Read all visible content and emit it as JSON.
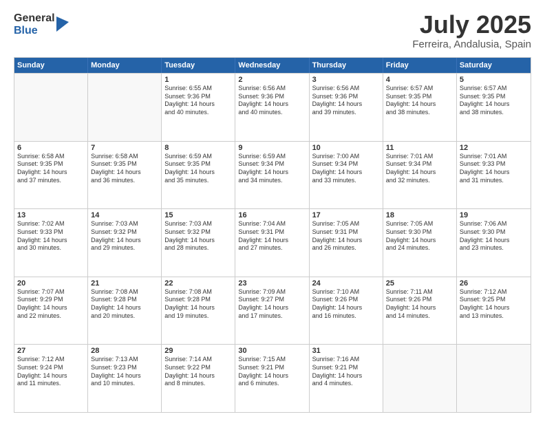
{
  "logo": {
    "general": "General",
    "blue": "Blue"
  },
  "title": {
    "month": "July 2025",
    "location": "Ferreira, Andalusia, Spain"
  },
  "weekdays": [
    "Sunday",
    "Monday",
    "Tuesday",
    "Wednesday",
    "Thursday",
    "Friday",
    "Saturday"
  ],
  "rows": [
    [
      {
        "day": "",
        "lines": [],
        "empty": true
      },
      {
        "day": "",
        "lines": [],
        "empty": true
      },
      {
        "day": "1",
        "lines": [
          "Sunrise: 6:55 AM",
          "Sunset: 9:36 PM",
          "Daylight: 14 hours",
          "and 40 minutes."
        ]
      },
      {
        "day": "2",
        "lines": [
          "Sunrise: 6:56 AM",
          "Sunset: 9:36 PM",
          "Daylight: 14 hours",
          "and 40 minutes."
        ]
      },
      {
        "day": "3",
        "lines": [
          "Sunrise: 6:56 AM",
          "Sunset: 9:36 PM",
          "Daylight: 14 hours",
          "and 39 minutes."
        ]
      },
      {
        "day": "4",
        "lines": [
          "Sunrise: 6:57 AM",
          "Sunset: 9:35 PM",
          "Daylight: 14 hours",
          "and 38 minutes."
        ]
      },
      {
        "day": "5",
        "lines": [
          "Sunrise: 6:57 AM",
          "Sunset: 9:35 PM",
          "Daylight: 14 hours",
          "and 38 minutes."
        ]
      }
    ],
    [
      {
        "day": "6",
        "lines": [
          "Sunrise: 6:58 AM",
          "Sunset: 9:35 PM",
          "Daylight: 14 hours",
          "and 37 minutes."
        ]
      },
      {
        "day": "7",
        "lines": [
          "Sunrise: 6:58 AM",
          "Sunset: 9:35 PM",
          "Daylight: 14 hours",
          "and 36 minutes."
        ]
      },
      {
        "day": "8",
        "lines": [
          "Sunrise: 6:59 AM",
          "Sunset: 9:35 PM",
          "Daylight: 14 hours",
          "and 35 minutes."
        ]
      },
      {
        "day": "9",
        "lines": [
          "Sunrise: 6:59 AM",
          "Sunset: 9:34 PM",
          "Daylight: 14 hours",
          "and 34 minutes."
        ]
      },
      {
        "day": "10",
        "lines": [
          "Sunrise: 7:00 AM",
          "Sunset: 9:34 PM",
          "Daylight: 14 hours",
          "and 33 minutes."
        ]
      },
      {
        "day": "11",
        "lines": [
          "Sunrise: 7:01 AM",
          "Sunset: 9:34 PM",
          "Daylight: 14 hours",
          "and 32 minutes."
        ]
      },
      {
        "day": "12",
        "lines": [
          "Sunrise: 7:01 AM",
          "Sunset: 9:33 PM",
          "Daylight: 14 hours",
          "and 31 minutes."
        ]
      }
    ],
    [
      {
        "day": "13",
        "lines": [
          "Sunrise: 7:02 AM",
          "Sunset: 9:33 PM",
          "Daylight: 14 hours",
          "and 30 minutes."
        ]
      },
      {
        "day": "14",
        "lines": [
          "Sunrise: 7:03 AM",
          "Sunset: 9:32 PM",
          "Daylight: 14 hours",
          "and 29 minutes."
        ]
      },
      {
        "day": "15",
        "lines": [
          "Sunrise: 7:03 AM",
          "Sunset: 9:32 PM",
          "Daylight: 14 hours",
          "and 28 minutes."
        ]
      },
      {
        "day": "16",
        "lines": [
          "Sunrise: 7:04 AM",
          "Sunset: 9:31 PM",
          "Daylight: 14 hours",
          "and 27 minutes."
        ]
      },
      {
        "day": "17",
        "lines": [
          "Sunrise: 7:05 AM",
          "Sunset: 9:31 PM",
          "Daylight: 14 hours",
          "and 26 minutes."
        ]
      },
      {
        "day": "18",
        "lines": [
          "Sunrise: 7:05 AM",
          "Sunset: 9:30 PM",
          "Daylight: 14 hours",
          "and 24 minutes."
        ]
      },
      {
        "day": "19",
        "lines": [
          "Sunrise: 7:06 AM",
          "Sunset: 9:30 PM",
          "Daylight: 14 hours",
          "and 23 minutes."
        ]
      }
    ],
    [
      {
        "day": "20",
        "lines": [
          "Sunrise: 7:07 AM",
          "Sunset: 9:29 PM",
          "Daylight: 14 hours",
          "and 22 minutes."
        ]
      },
      {
        "day": "21",
        "lines": [
          "Sunrise: 7:08 AM",
          "Sunset: 9:28 PM",
          "Daylight: 14 hours",
          "and 20 minutes."
        ]
      },
      {
        "day": "22",
        "lines": [
          "Sunrise: 7:08 AM",
          "Sunset: 9:28 PM",
          "Daylight: 14 hours",
          "and 19 minutes."
        ]
      },
      {
        "day": "23",
        "lines": [
          "Sunrise: 7:09 AM",
          "Sunset: 9:27 PM",
          "Daylight: 14 hours",
          "and 17 minutes."
        ]
      },
      {
        "day": "24",
        "lines": [
          "Sunrise: 7:10 AM",
          "Sunset: 9:26 PM",
          "Daylight: 14 hours",
          "and 16 minutes."
        ]
      },
      {
        "day": "25",
        "lines": [
          "Sunrise: 7:11 AM",
          "Sunset: 9:26 PM",
          "Daylight: 14 hours",
          "and 14 minutes."
        ]
      },
      {
        "day": "26",
        "lines": [
          "Sunrise: 7:12 AM",
          "Sunset: 9:25 PM",
          "Daylight: 14 hours",
          "and 13 minutes."
        ]
      }
    ],
    [
      {
        "day": "27",
        "lines": [
          "Sunrise: 7:12 AM",
          "Sunset: 9:24 PM",
          "Daylight: 14 hours",
          "and 11 minutes."
        ]
      },
      {
        "day": "28",
        "lines": [
          "Sunrise: 7:13 AM",
          "Sunset: 9:23 PM",
          "Daylight: 14 hours",
          "and 10 minutes."
        ]
      },
      {
        "day": "29",
        "lines": [
          "Sunrise: 7:14 AM",
          "Sunset: 9:22 PM",
          "Daylight: 14 hours",
          "and 8 minutes."
        ]
      },
      {
        "day": "30",
        "lines": [
          "Sunrise: 7:15 AM",
          "Sunset: 9:21 PM",
          "Daylight: 14 hours",
          "and 6 minutes."
        ]
      },
      {
        "day": "31",
        "lines": [
          "Sunrise: 7:16 AM",
          "Sunset: 9:21 PM",
          "Daylight: 14 hours",
          "and 4 minutes."
        ]
      },
      {
        "day": "",
        "lines": [],
        "empty": true
      },
      {
        "day": "",
        "lines": [],
        "empty": true
      }
    ]
  ]
}
